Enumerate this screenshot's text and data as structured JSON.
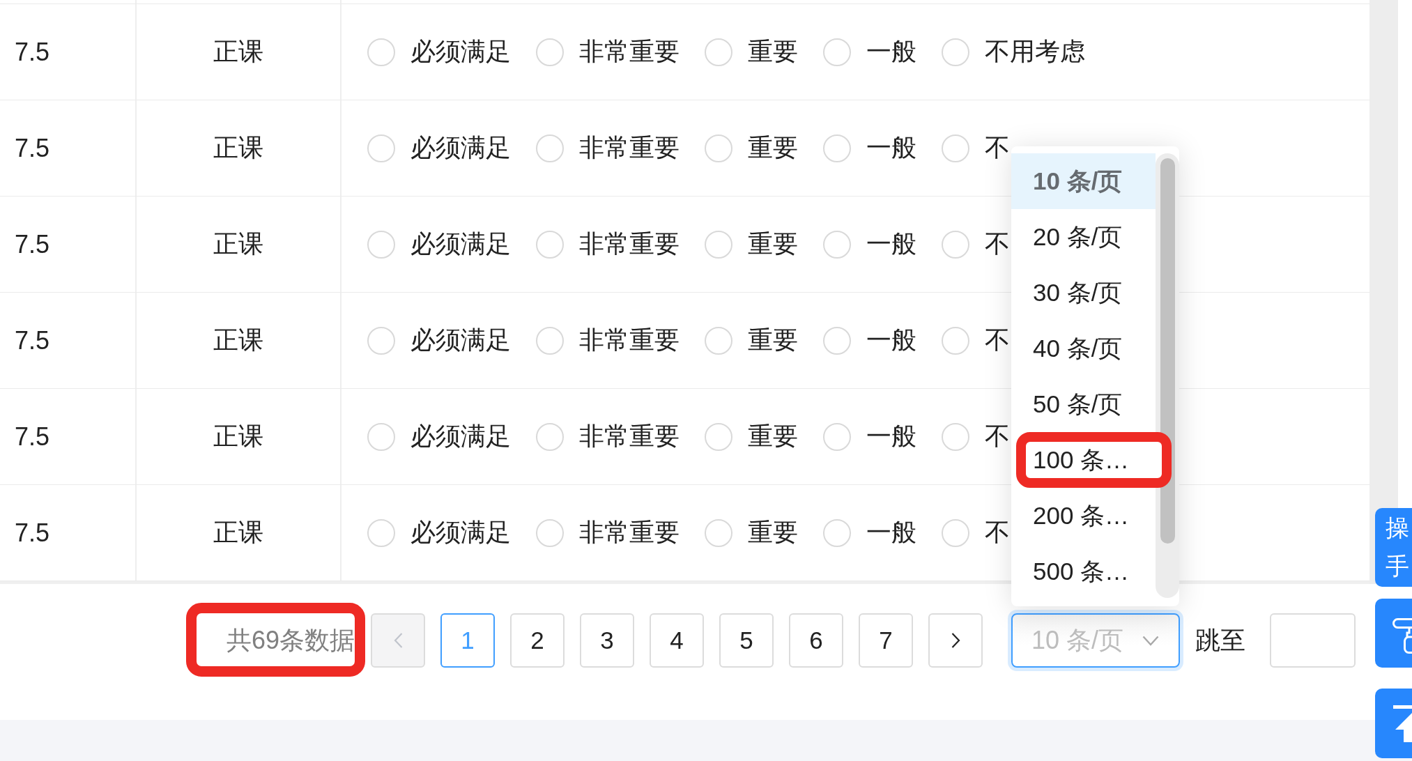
{
  "table": {
    "rows": [
      {
        "cells": [
          "7.5",
          "正课"
        ],
        "options": [
          {
            "label": "必须满足",
            "selected": false
          },
          {
            "label": "非常重要",
            "selected": false
          },
          {
            "label": "重要",
            "selected": false
          },
          {
            "label": "一般",
            "selected": false
          },
          {
            "label": "不用考虑",
            "selected": false
          }
        ]
      },
      {
        "cells": [
          "7.5",
          "正课"
        ],
        "options": [
          {
            "label": "必须满足",
            "selected": false
          },
          {
            "label": "非常重要",
            "selected": false
          },
          {
            "label": "重要",
            "selected": false
          },
          {
            "label": "一般",
            "selected": false
          },
          {
            "label": "不",
            "selected": false
          }
        ]
      },
      {
        "cells": [
          "7.5",
          "正课"
        ],
        "options": [
          {
            "label": "必须满足",
            "selected": false
          },
          {
            "label": "非常重要",
            "selected": false
          },
          {
            "label": "重要",
            "selected": false
          },
          {
            "label": "一般",
            "selected": false
          },
          {
            "label": "不",
            "selected": false
          }
        ]
      },
      {
        "cells": [
          "7.5",
          "正课"
        ],
        "options": [
          {
            "label": "必须满足",
            "selected": false
          },
          {
            "label": "非常重要",
            "selected": false
          },
          {
            "label": "重要",
            "selected": false
          },
          {
            "label": "一般",
            "selected": false
          },
          {
            "label": "不",
            "selected": false
          }
        ]
      },
      {
        "cells": [
          "7.5",
          "正课"
        ],
        "options": [
          {
            "label": "必须满足",
            "selected": false
          },
          {
            "label": "非常重要",
            "selected": false
          },
          {
            "label": "重要",
            "selected": false
          },
          {
            "label": "一般",
            "selected": false
          },
          {
            "label": "不",
            "selected": false
          }
        ]
      },
      {
        "cells": [
          "7.5",
          "正课"
        ],
        "options": [
          {
            "label": "必须满足",
            "selected": false
          },
          {
            "label": "非常重要",
            "selected": false
          },
          {
            "label": "重要",
            "selected": false
          },
          {
            "label": "一般",
            "selected": false
          },
          {
            "label": "不",
            "selected": false
          }
        ]
      }
    ]
  },
  "pagination": {
    "total": {
      "text": "共69条数据",
      "highlighted": true
    },
    "prev": {
      "disabled": true
    },
    "pages": [
      {
        "label": "1",
        "selected": true
      },
      {
        "label": "2",
        "selected": false
      },
      {
        "label": "3",
        "selected": false
      },
      {
        "label": "4",
        "selected": false
      },
      {
        "label": "5",
        "selected": false
      },
      {
        "label": "6",
        "selected": false
      },
      {
        "label": "7",
        "selected": false
      }
    ],
    "next": {
      "disabled": false
    },
    "page_size": {
      "placeholder": "10 条/页",
      "expanded": true,
      "options": [
        {
          "label": "10 条/页",
          "selected": true,
          "highlighted": false
        },
        {
          "label": "20 条/页",
          "selected": false,
          "highlighted": false
        },
        {
          "label": "30 条/页",
          "selected": false,
          "highlighted": false
        },
        {
          "label": "40 条/页",
          "selected": false,
          "highlighted": false
        },
        {
          "label": "50 条/页",
          "selected": false,
          "highlighted": false
        },
        {
          "label": "100 条…",
          "selected": false,
          "highlighted": true
        },
        {
          "label": "200 条…",
          "selected": false,
          "highlighted": false
        },
        {
          "label": "500 条…",
          "selected": false,
          "highlighted": false
        }
      ]
    },
    "jump_label": "跳至"
  },
  "floating_buttons": [
    {
      "kind": "text",
      "lines": [
        "操",
        "手"
      ]
    },
    {
      "kind": "roller"
    },
    {
      "kind": "back_to_top"
    }
  ]
}
